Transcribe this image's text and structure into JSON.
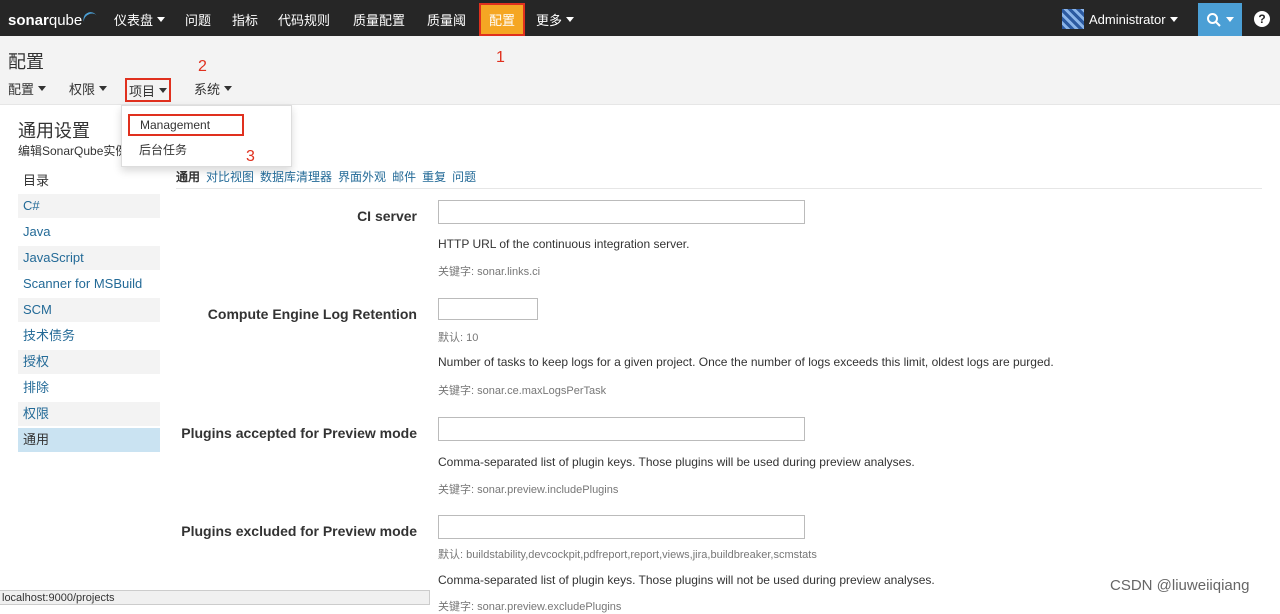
{
  "topbar": {
    "logo_a": "sonar",
    "logo_b": "qube",
    "nav": [
      "仪表盘",
      "问题",
      "指标",
      "代码规则",
      "质量配置",
      "质量阈",
      "配置",
      "更多"
    ],
    "user": "Administrator"
  },
  "page": {
    "title": "配置",
    "subnav": [
      "配置",
      "权限",
      "项目",
      "系统"
    ],
    "annotations": [
      "1",
      "2",
      "3"
    ]
  },
  "dropdown": {
    "items": [
      "Management",
      "后台任务"
    ]
  },
  "settings": {
    "title": "通用设置",
    "description": "编辑SonarQube实例",
    "sidebar_header": "目录",
    "sidebar_items": [
      "C#",
      "Java",
      "JavaScript",
      "Scanner for MSBuild",
      "SCM",
      "技术债务",
      "授权",
      "排除",
      "权限",
      "通用"
    ],
    "tabs": [
      "通用",
      "对比视图",
      "数据库清理器",
      "界面外观",
      "邮件",
      "重复",
      "问题"
    ],
    "fields": [
      {
        "label": "CI server",
        "default": "",
        "note": "HTTP URL of the continuous integration server.",
        "key": "关键字: sonar.links.ci"
      },
      {
        "label": "Compute Engine Log Retention",
        "default": "默认: 10",
        "note": "Number of tasks to keep logs for a given project. Once the number of logs exceeds this limit, oldest logs are purged.",
        "key": "关键字: sonar.ce.maxLogsPerTask"
      },
      {
        "label": "Plugins accepted for Preview mode",
        "default": "",
        "note": "Comma-separated list of plugin keys. Those plugins will be used during preview analyses.",
        "key": "关键字: sonar.preview.includePlugins"
      },
      {
        "label": "Plugins excluded for Preview mode",
        "default": "默认: buildstability,devcockpit,pdfreport,report,views,jira,buildbreaker,scmstats",
        "note": "Comma-separated list of plugin keys. Those plugins will not be used during preview analyses.",
        "key": "关键字: sonar.preview.excludePlugins"
      }
    ]
  },
  "statusbar": "localhost:9000/projects",
  "watermark": "CSDN @liuweiiqiang"
}
